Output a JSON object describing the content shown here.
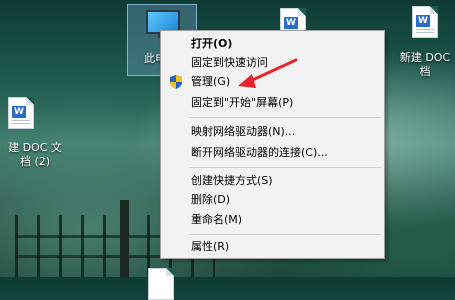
{
  "desktop": {
    "icons": [
      {
        "label_line1": "新建 DOC",
        "label_line2": "档"
      },
      {
        "label_line1": "建 DOC 文",
        "label_line2": "档 (2)"
      },
      {
        "label_line1": "此电"
      }
    ]
  },
  "context_menu": {
    "items": [
      {
        "label": "打开(O)",
        "bold": true
      },
      {
        "label": "固定到快速访问"
      },
      {
        "label": "管理(G)",
        "icon": "uac-shield-icon"
      },
      {
        "label": "固定到\"开始\"屏幕(P)"
      },
      {
        "label": "映射网络驱动器(N)..."
      },
      {
        "label": "断开网络驱动器的连接(C)..."
      },
      {
        "label": "创建快捷方式(S)"
      },
      {
        "label": "删除(D)"
      },
      {
        "label": "重命名(M)"
      },
      {
        "label": "属性(R)"
      }
    ]
  },
  "colors": {
    "annotation_arrow": "#e8232b",
    "menu_background": "#f2f2f2"
  }
}
